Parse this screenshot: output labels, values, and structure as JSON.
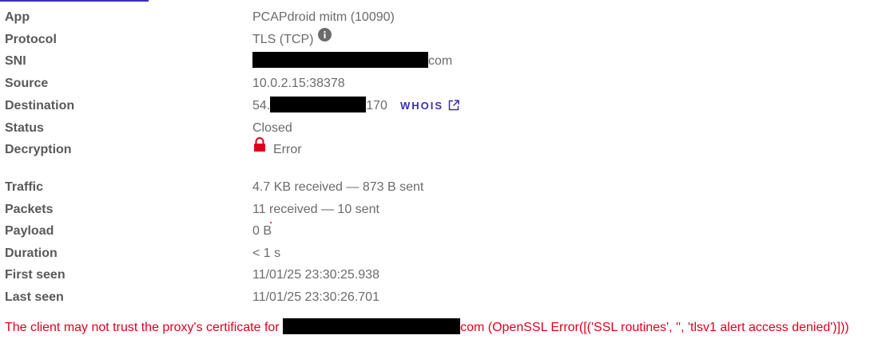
{
  "details": {
    "app": {
      "label": "App",
      "value": "PCAPdroid mitm (10090)"
    },
    "protocol": {
      "label": "Protocol",
      "value": "TLS (TCP)"
    },
    "sni": {
      "label": "SNI",
      "value_suffix": "com"
    },
    "source": {
      "label": "Source",
      "value": "10.0.2.15:38378"
    },
    "destination": {
      "label": "Destination",
      "value_prefix": "54.",
      "value_suffix": "170",
      "whois_label": "WHOIS"
    },
    "status": {
      "label": "Status",
      "value": "Closed"
    },
    "decryption": {
      "label": "Decryption",
      "value": "Error"
    }
  },
  "stats": {
    "traffic": {
      "label": "Traffic",
      "value": "4.7 KB received — 873 B sent"
    },
    "packets": {
      "label": "Packets",
      "value": "11 received — 10 sent"
    },
    "payload": {
      "label": "Payload",
      "value": "0 B"
    },
    "duration": {
      "label": "Duration",
      "value": "< 1 s"
    },
    "first_seen": {
      "label": "First seen",
      "value": "11/01/25 23:30:25.938"
    },
    "last_seen": {
      "label": "Last seen",
      "value": "11/01/25 23:30:26.701"
    }
  },
  "error_message": {
    "prefix": "The client may not trust the proxy's certificate for ",
    "suffix": "com (OpenSSL Error([('SSL routines', '', 'tlsv1 alert access denied')]))"
  },
  "colors": {
    "accent": "#3b2fb0",
    "error": "#e0001b",
    "label": "#595959",
    "value": "#6b6b6b"
  },
  "icons": {
    "protocol_info": "info-icon",
    "whois_link": "external-link-icon",
    "decryption_status": "lock-icon"
  }
}
